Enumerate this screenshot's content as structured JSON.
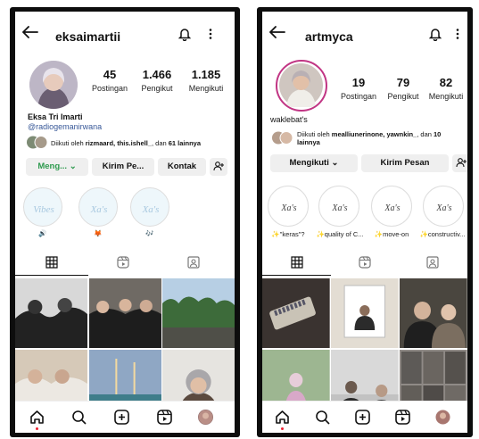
{
  "profile_left": {
    "username": "eksaimartii",
    "posts": "45",
    "posts_label": "Postingan",
    "followers": "1.466",
    "followers_label": "Pengikut",
    "following": "1.185",
    "following_label": "Mengikuti",
    "full_name": "Eksa Tri Imarti",
    "bio_handle": "@radiogemanirwana",
    "followed_by_prefix": "Diikuti oleh ",
    "followed_by_names": "rizmaard, this.ishell_",
    "followed_by_mid": ", dan ",
    "followed_by_count": "61 lainnya",
    "buttons": {
      "follow": "Meng...",
      "message": "Kirim Pe...",
      "contact": "Kontak"
    },
    "highlights": [
      {
        "label": "🔊",
        "cover": "Vibes"
      },
      {
        "label": "🦊",
        "cover": "Xa's"
      },
      {
        "label": "🎶",
        "cover": "Xa's"
      }
    ]
  },
  "profile_right": {
    "username": "artmyca",
    "posts": "19",
    "posts_label": "Postingan",
    "followers": "79",
    "followers_label": "Pengikut",
    "following": "82",
    "following_label": "Mengikuti",
    "bio": "waklebat's",
    "followed_by_prefix": "Diikuti oleh ",
    "followed_by_names": "mealliunerinone, yawnkin_",
    "followed_by_mid": ", dan ",
    "followed_by_count": "10",
    "followed_by_line2": "lainnya",
    "buttons": {
      "follow": "Mengikuti",
      "message": "Kirim Pesan"
    },
    "highlights": [
      {
        "label": "✨\"keras\"?",
        "cover": "Xa's"
      },
      {
        "label": "✨quality of C...",
        "cover": "Xa's"
      },
      {
        "label": "✨move-on",
        "cover": "Xa's"
      },
      {
        "label": "✨constructiv...",
        "cover": "Xa's"
      }
    ]
  },
  "icons": [
    "back-arrow-icon",
    "bell-icon",
    "more-options-icon",
    "grid-icon",
    "reels-icon",
    "tagged-icon",
    "home-icon",
    "search-icon",
    "create-icon",
    "reels-nav-icon",
    "profile-avatar-icon",
    "add-person-icon",
    "chevron-down-icon"
  ],
  "colors": {
    "follow_button_text": "#2e9a4e",
    "story_ring": "#c13584",
    "nav_dot": "#e22233"
  }
}
